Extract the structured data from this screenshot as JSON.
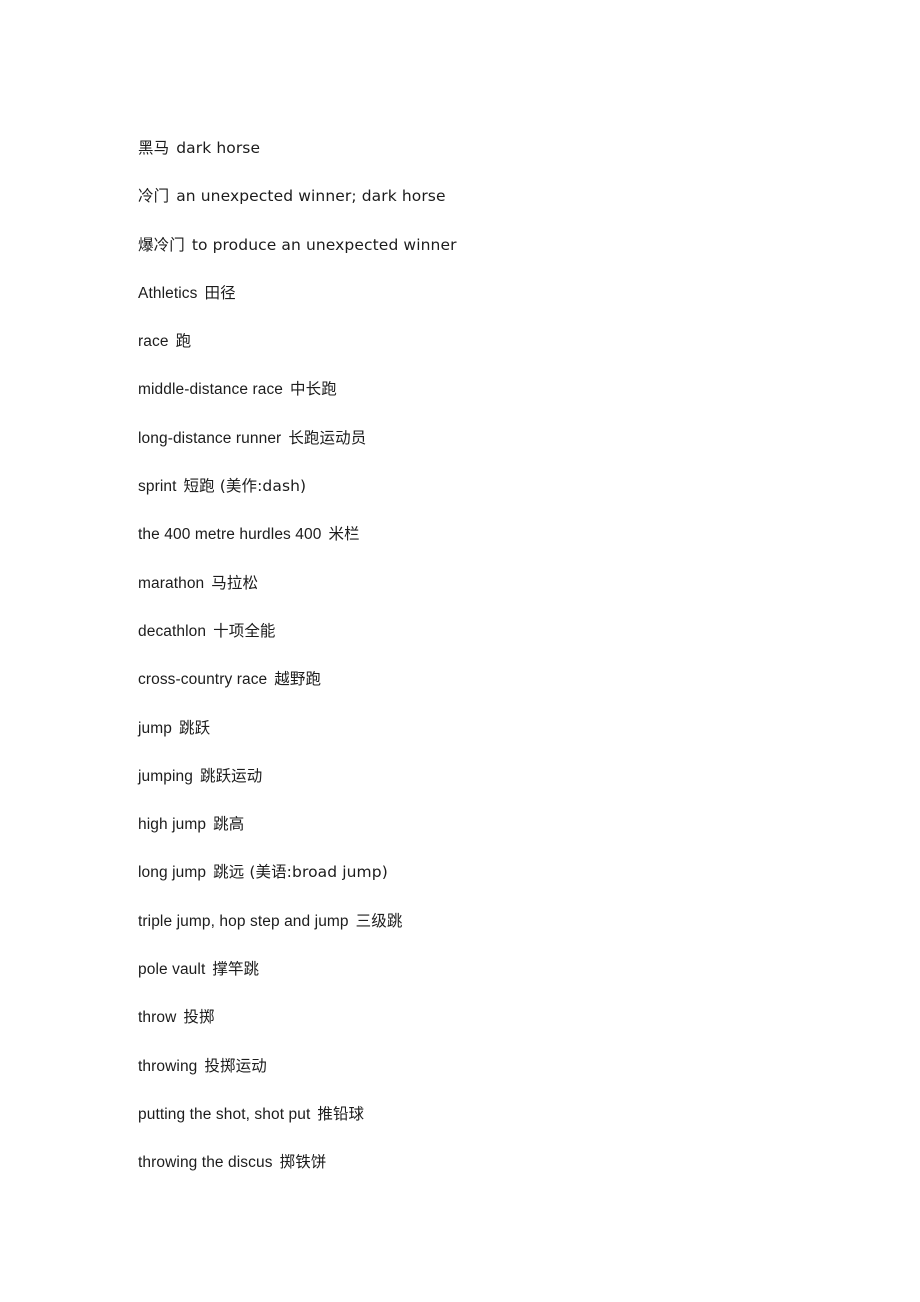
{
  "document": {
    "page_background": "#ffffff",
    "text_color": "#1c1c1c",
    "entries": [
      {
        "term": "黑马",
        "gloss": "dark horse"
      },
      {
        "term": "冷门",
        "gloss": "an unexpected winner; dark horse"
      },
      {
        "term": "爆冷门",
        "gloss": "to produce an unexpected winner"
      },
      {
        "term": "Athletics",
        "gloss": "田径"
      },
      {
        "term": "race",
        "gloss": "跑"
      },
      {
        "term": "middle-distance race",
        "gloss": "中长跑"
      },
      {
        "term": "long-distance runner",
        "gloss": "长跑运动员"
      },
      {
        "term": "sprint",
        "gloss": "短跑  (美作:dash)"
      },
      {
        "term": "the 400 metre hurdles 400",
        "gloss": "米栏"
      },
      {
        "term": "marathon",
        "gloss": "马拉松"
      },
      {
        "term": "decathlon",
        "gloss": "十项全能"
      },
      {
        "term": "cross-country race",
        "gloss": "越野跑"
      },
      {
        "term": "jump",
        "gloss": "跳跃"
      },
      {
        "term": "jumping",
        "gloss": "跳跃运动"
      },
      {
        "term": "high jump",
        "gloss": "跳高"
      },
      {
        "term": "long jump",
        "gloss": "跳远  (美语:broad jump)"
      },
      {
        "term": "triple jump, hop step and jump",
        "gloss": "三级跳"
      },
      {
        "term": "pole vault",
        "gloss": "撑竿跳"
      },
      {
        "term": "throw",
        "gloss": "投掷"
      },
      {
        "term": "throwing",
        "gloss": "投掷运动"
      },
      {
        "term": "putting the shot, shot put",
        "gloss": "推铅球"
      },
      {
        "term": "throwing the discus",
        "gloss": "掷铁饼"
      }
    ]
  }
}
